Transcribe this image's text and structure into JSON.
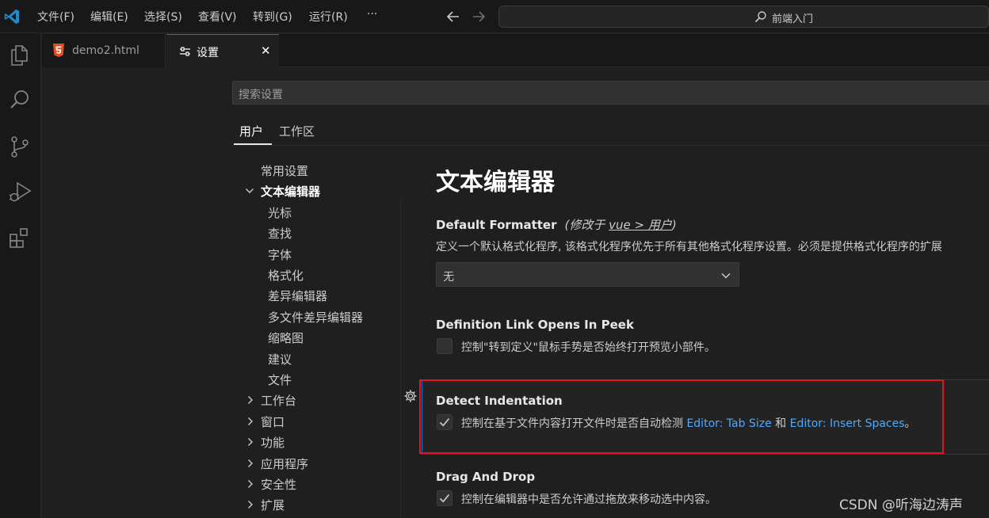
{
  "titlebar": {
    "menu": [
      "文件(F)",
      "编辑(E)",
      "选择(S)",
      "查看(V)",
      "转到(G)",
      "运行(R)",
      "···"
    ],
    "command_center": "前端入门"
  },
  "tabs": [
    {
      "label": "demo2.html",
      "icon": "html5-icon"
    },
    {
      "label": "设置",
      "icon": "settings-sliders-icon",
      "close": "✕"
    }
  ],
  "settings": {
    "search_placeholder": "搜索设置",
    "scopes": [
      "用户",
      "工作区"
    ],
    "toc": {
      "common": "常用设置",
      "editor": "文本编辑器",
      "editor_children": [
        "光标",
        "查找",
        "字体",
        "格式化",
        "差异编辑器",
        "多文件差异编辑器",
        "缩略图",
        "建议",
        "文件"
      ],
      "collapsed": [
        "工作台",
        "窗口",
        "功能",
        "应用程序",
        "安全性",
        "扩展"
      ]
    },
    "section_title": "文本编辑器",
    "items": {
      "default_formatter": {
        "title": "Default Formatter",
        "modified_prefix": "(修改于 ",
        "modified_link": "vue > 用户",
        "modified_suffix": ")",
        "description": "定义一个默认格式化程序, 该格式化程序优先于所有其他格式化程序设置。必须是提供格式化程序的扩展",
        "value": "无"
      },
      "definition_link": {
        "title": "Definition Link Opens In Peek",
        "description": "控制\"转到定义\"鼠标手势是否始终打开预览小部件。",
        "checked": false
      },
      "detect_indentation": {
        "title": "Detect Indentation",
        "desc_before": "控制在基于文件内容打开文件时是否自动检测 ",
        "link1": "Editor: Tab Size",
        "desc_mid": " 和 ",
        "link2": "Editor: Insert Spaces",
        "desc_after": "。",
        "checked": true
      },
      "drag_and_drop": {
        "title": "Drag And Drop",
        "description": "控制在编辑器中是否允许通过拖放来移动选中内容。",
        "checked": true
      }
    }
  },
  "watermark": "CSDN @听海边涛声",
  "colors": {
    "accent": "#0078d4",
    "link": "#4daafc",
    "highlight_box": "#e81123"
  }
}
